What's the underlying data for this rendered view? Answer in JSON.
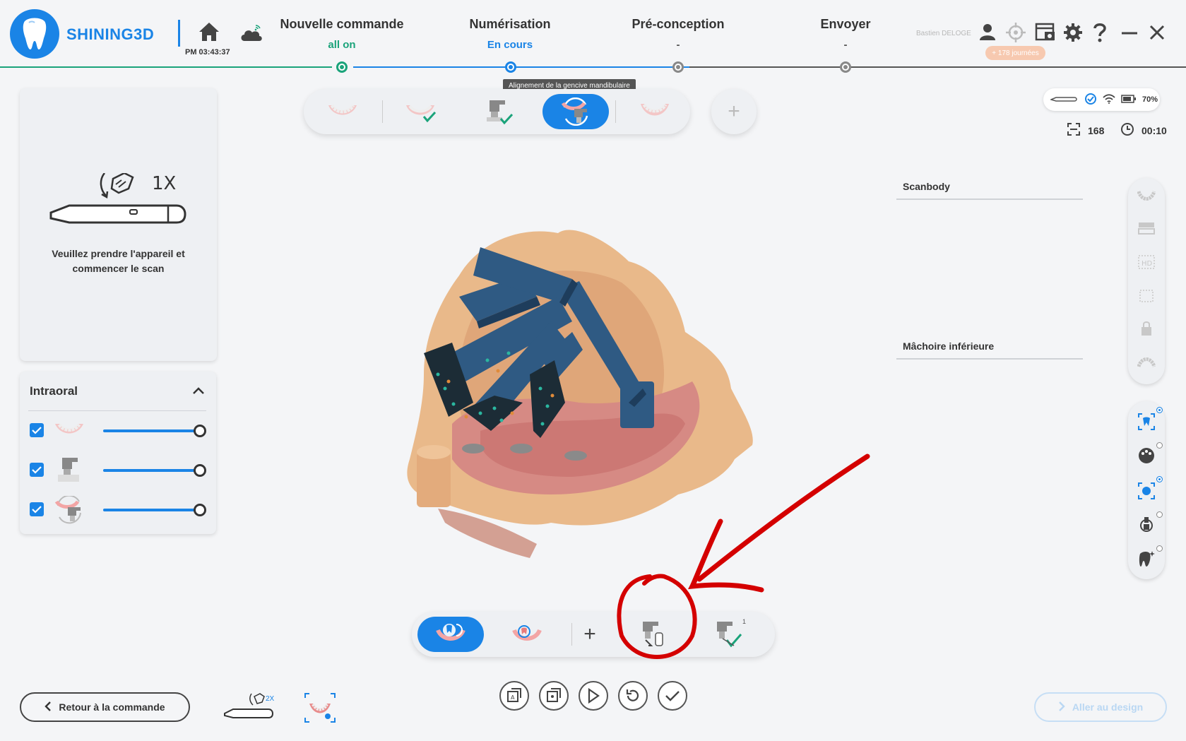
{
  "header": {
    "brand": "SHINING3D",
    "clock": "PM 03:43:37",
    "steps": [
      {
        "label": "Nouvelle commande",
        "status": "all on"
      },
      {
        "label": "Numérisation",
        "status": "En cours"
      },
      {
        "label": "Pré-conception",
        "status": "-"
      },
      {
        "label": "Envoyer",
        "status": "-"
      }
    ],
    "user_name": "Bastien DELOGE",
    "days_badge": "+ 178 journées",
    "icons": [
      "user-icon",
      "target-icon",
      "screenshot-icon",
      "gear-icon",
      "help-icon",
      "minimize-icon",
      "close-icon"
    ]
  },
  "tooltip": "Alignement de la gencive mandibulaire",
  "instruction": {
    "count_label": "1X",
    "text_line1": "Veuillez prendre l'appareil et",
    "text_line2": "commencer le scan"
  },
  "intraoral": {
    "title": "Intraoral",
    "layers": [
      {
        "name": "lower-jaw-layer",
        "checked": true
      },
      {
        "name": "scanbody-layer",
        "checked": true
      },
      {
        "name": "gingiva-alignment-layer",
        "checked": true
      }
    ]
  },
  "status": {
    "battery": "70%",
    "frames": "168",
    "timer": "00:10"
  },
  "info_panel": {
    "scanbody_label": "Scanbody",
    "lower_jaw_label": "Mâchoire inférieure"
  },
  "bottom": {
    "back_label": "Retour à la commande",
    "design_label": "Aller au design",
    "mini_count": "2X",
    "scanbody_count": "1"
  },
  "colors": {
    "accent": "#1a84e6",
    "success": "#1aa37a",
    "annotation": "#d40000"
  }
}
